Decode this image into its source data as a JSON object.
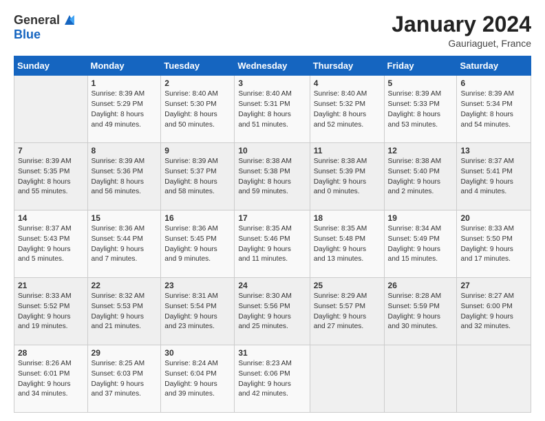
{
  "logo": {
    "general": "General",
    "blue": "Blue"
  },
  "title": "January 2024",
  "location": "Gauriaguet, France",
  "days_header": [
    "Sunday",
    "Monday",
    "Tuesday",
    "Wednesday",
    "Thursday",
    "Friday",
    "Saturday"
  ],
  "weeks": [
    [
      {
        "day": "",
        "info": ""
      },
      {
        "day": "1",
        "info": "Sunrise: 8:39 AM\nSunset: 5:29 PM\nDaylight: 8 hours\nand 49 minutes."
      },
      {
        "day": "2",
        "info": "Sunrise: 8:40 AM\nSunset: 5:30 PM\nDaylight: 8 hours\nand 50 minutes."
      },
      {
        "day": "3",
        "info": "Sunrise: 8:40 AM\nSunset: 5:31 PM\nDaylight: 8 hours\nand 51 minutes."
      },
      {
        "day": "4",
        "info": "Sunrise: 8:40 AM\nSunset: 5:32 PM\nDaylight: 8 hours\nand 52 minutes."
      },
      {
        "day": "5",
        "info": "Sunrise: 8:39 AM\nSunset: 5:33 PM\nDaylight: 8 hours\nand 53 minutes."
      },
      {
        "day": "6",
        "info": "Sunrise: 8:39 AM\nSunset: 5:34 PM\nDaylight: 8 hours\nand 54 minutes."
      }
    ],
    [
      {
        "day": "7",
        "info": "Sunrise: 8:39 AM\nSunset: 5:35 PM\nDaylight: 8 hours\nand 55 minutes."
      },
      {
        "day": "8",
        "info": "Sunrise: 8:39 AM\nSunset: 5:36 PM\nDaylight: 8 hours\nand 56 minutes."
      },
      {
        "day": "9",
        "info": "Sunrise: 8:39 AM\nSunset: 5:37 PM\nDaylight: 8 hours\nand 58 minutes."
      },
      {
        "day": "10",
        "info": "Sunrise: 8:38 AM\nSunset: 5:38 PM\nDaylight: 8 hours\nand 59 minutes."
      },
      {
        "day": "11",
        "info": "Sunrise: 8:38 AM\nSunset: 5:39 PM\nDaylight: 9 hours\nand 0 minutes."
      },
      {
        "day": "12",
        "info": "Sunrise: 8:38 AM\nSunset: 5:40 PM\nDaylight: 9 hours\nand 2 minutes."
      },
      {
        "day": "13",
        "info": "Sunrise: 8:37 AM\nSunset: 5:41 PM\nDaylight: 9 hours\nand 4 minutes."
      }
    ],
    [
      {
        "day": "14",
        "info": "Sunrise: 8:37 AM\nSunset: 5:43 PM\nDaylight: 9 hours\nand 5 minutes."
      },
      {
        "day": "15",
        "info": "Sunrise: 8:36 AM\nSunset: 5:44 PM\nDaylight: 9 hours\nand 7 minutes."
      },
      {
        "day": "16",
        "info": "Sunrise: 8:36 AM\nSunset: 5:45 PM\nDaylight: 9 hours\nand 9 minutes."
      },
      {
        "day": "17",
        "info": "Sunrise: 8:35 AM\nSunset: 5:46 PM\nDaylight: 9 hours\nand 11 minutes."
      },
      {
        "day": "18",
        "info": "Sunrise: 8:35 AM\nSunset: 5:48 PM\nDaylight: 9 hours\nand 13 minutes."
      },
      {
        "day": "19",
        "info": "Sunrise: 8:34 AM\nSunset: 5:49 PM\nDaylight: 9 hours\nand 15 minutes."
      },
      {
        "day": "20",
        "info": "Sunrise: 8:33 AM\nSunset: 5:50 PM\nDaylight: 9 hours\nand 17 minutes."
      }
    ],
    [
      {
        "day": "21",
        "info": "Sunrise: 8:33 AM\nSunset: 5:52 PM\nDaylight: 9 hours\nand 19 minutes."
      },
      {
        "day": "22",
        "info": "Sunrise: 8:32 AM\nSunset: 5:53 PM\nDaylight: 9 hours\nand 21 minutes."
      },
      {
        "day": "23",
        "info": "Sunrise: 8:31 AM\nSunset: 5:54 PM\nDaylight: 9 hours\nand 23 minutes."
      },
      {
        "day": "24",
        "info": "Sunrise: 8:30 AM\nSunset: 5:56 PM\nDaylight: 9 hours\nand 25 minutes."
      },
      {
        "day": "25",
        "info": "Sunrise: 8:29 AM\nSunset: 5:57 PM\nDaylight: 9 hours\nand 27 minutes."
      },
      {
        "day": "26",
        "info": "Sunrise: 8:28 AM\nSunset: 5:59 PM\nDaylight: 9 hours\nand 30 minutes."
      },
      {
        "day": "27",
        "info": "Sunrise: 8:27 AM\nSunset: 6:00 PM\nDaylight: 9 hours\nand 32 minutes."
      }
    ],
    [
      {
        "day": "28",
        "info": "Sunrise: 8:26 AM\nSunset: 6:01 PM\nDaylight: 9 hours\nand 34 minutes."
      },
      {
        "day": "29",
        "info": "Sunrise: 8:25 AM\nSunset: 6:03 PM\nDaylight: 9 hours\nand 37 minutes."
      },
      {
        "day": "30",
        "info": "Sunrise: 8:24 AM\nSunset: 6:04 PM\nDaylight: 9 hours\nand 39 minutes."
      },
      {
        "day": "31",
        "info": "Sunrise: 8:23 AM\nSunset: 6:06 PM\nDaylight: 9 hours\nand 42 minutes."
      },
      {
        "day": "",
        "info": ""
      },
      {
        "day": "",
        "info": ""
      },
      {
        "day": "",
        "info": ""
      }
    ]
  ]
}
